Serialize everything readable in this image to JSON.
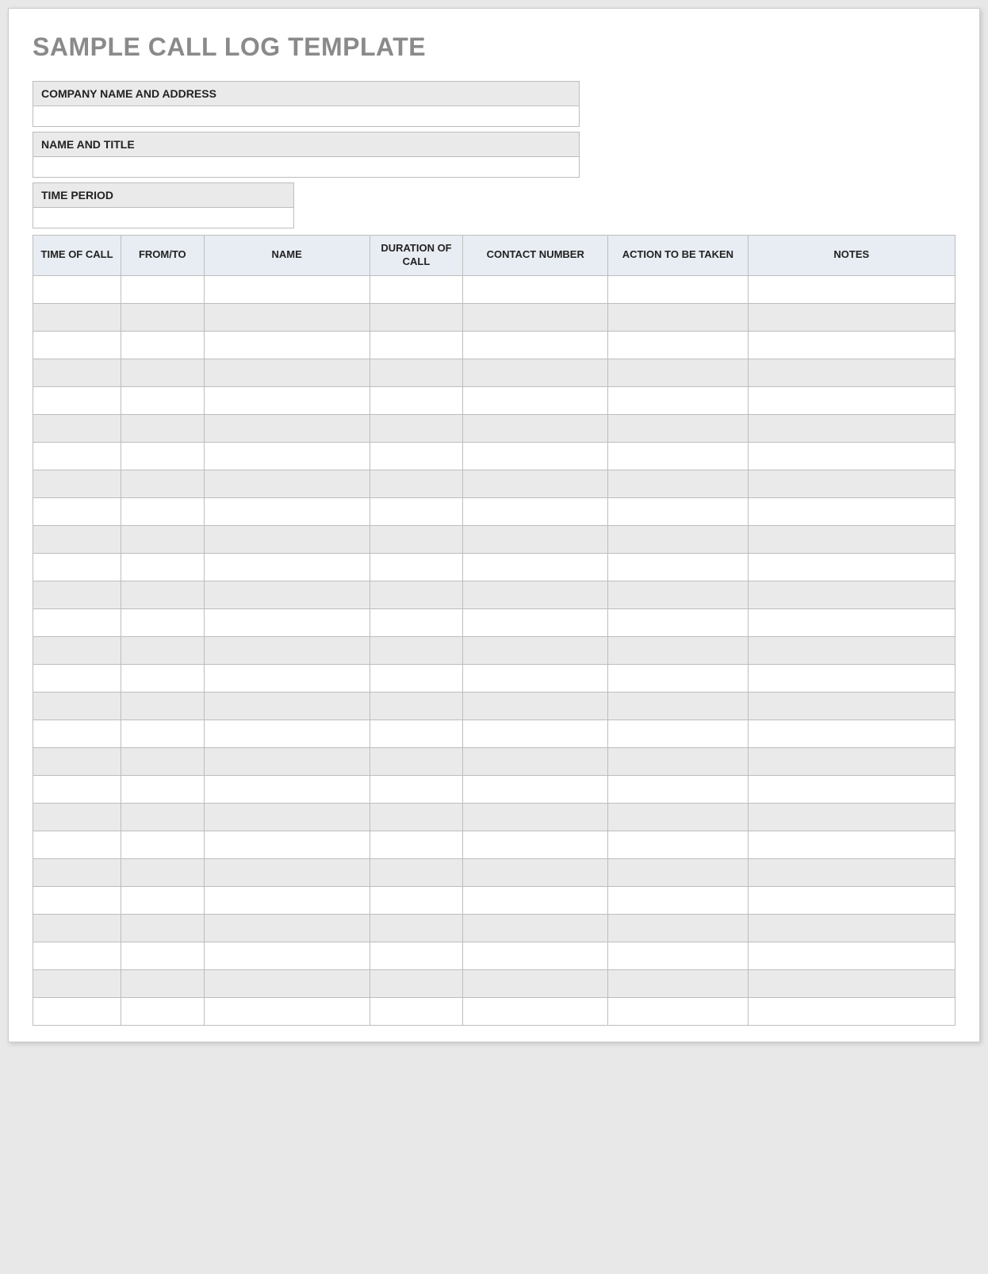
{
  "title": "SAMPLE CALL LOG TEMPLATE",
  "info": {
    "company_label": "COMPANY NAME AND ADDRESS",
    "company_value": "",
    "name_label": "NAME AND TITLE",
    "name_value": "",
    "period_label": "TIME PERIOD",
    "period_value": ""
  },
  "table": {
    "headers": {
      "time_of_call": "TIME OF CALL",
      "from_to": "FROM/TO",
      "name": "NAME",
      "duration": "DURATION OF CALL",
      "contact_number": "CONTACT NUMBER",
      "action": "ACTION TO BE TAKEN",
      "notes": "NOTES"
    },
    "row_count": 27,
    "rows": []
  }
}
